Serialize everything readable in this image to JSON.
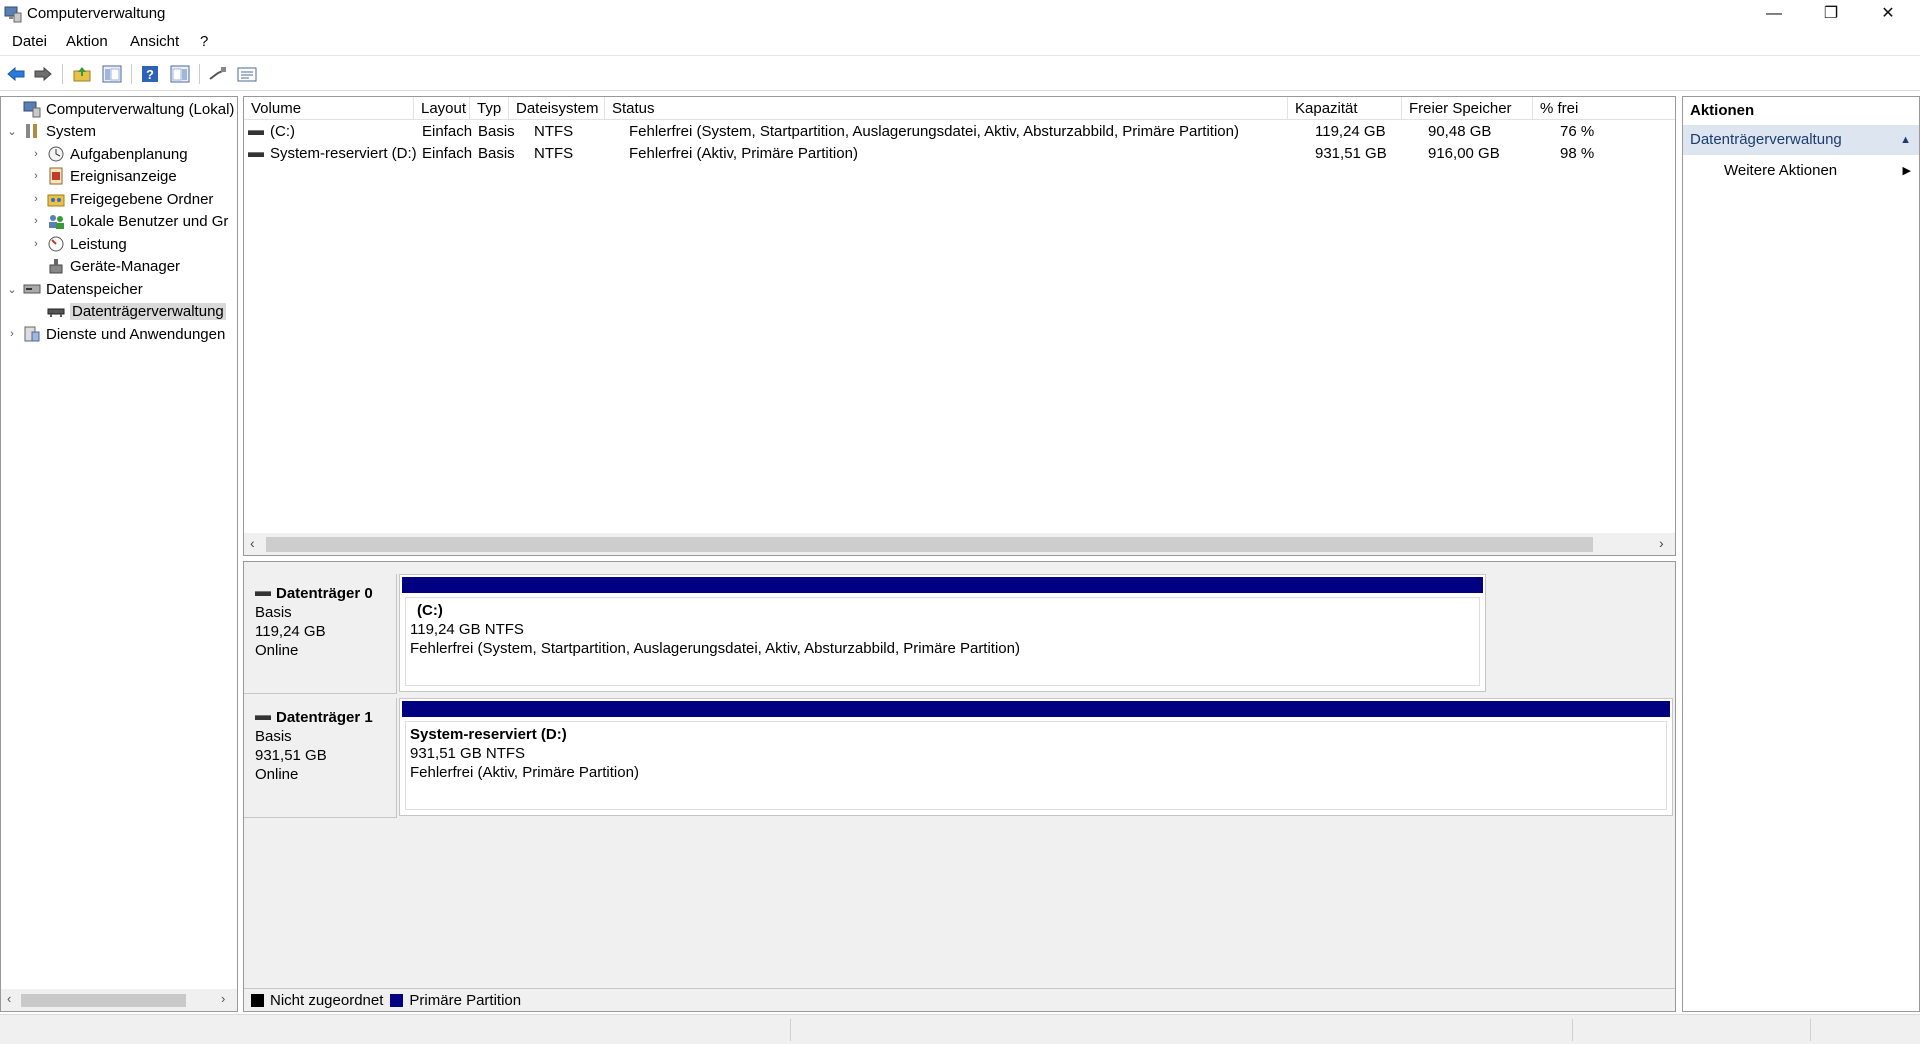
{
  "window": {
    "title": "Computerverwaltung",
    "minimize_glyph": "—",
    "maximize_glyph": "❐",
    "close_glyph": "✕"
  },
  "menu": {
    "items": [
      "Datei",
      "Aktion",
      "Ansicht",
      "?"
    ]
  },
  "toolbar": {
    "icons": [
      "back-arrow-icon",
      "forward-arrow-icon",
      "up-folder-icon",
      "show-hide-console-tree-icon",
      "help-icon",
      "show-hide-action-pane-icon",
      "connect-icon",
      "properties-icon"
    ]
  },
  "tree": {
    "items": [
      {
        "label": "Computerverwaltung (Lokal)",
        "chev": "",
        "icon": "computer-management-icon",
        "level": 0
      },
      {
        "label": "System",
        "chev": "⌄",
        "icon": "system-tools-icon",
        "level": 0
      },
      {
        "label": "Aufgabenplanung",
        "chev": "›",
        "icon": "task-scheduler-icon",
        "level": 1
      },
      {
        "label": "Ereignisanzeige",
        "chev": "›",
        "icon": "event-viewer-icon",
        "level": 1
      },
      {
        "label": "Freigegebene Ordner",
        "chev": "›",
        "icon": "shared-folders-icon",
        "level": 1
      },
      {
        "label": "Lokale Benutzer und Gr",
        "chev": "›",
        "icon": "local-users-icon",
        "level": 1
      },
      {
        "label": "Leistung",
        "chev": "›",
        "icon": "performance-icon",
        "level": 1
      },
      {
        "label": "Geräte-Manager",
        "chev": "",
        "icon": "device-manager-icon",
        "level": 1
      },
      {
        "label": "Datenspeicher",
        "chev": "⌄",
        "icon": "storage-icon",
        "level": 0
      },
      {
        "label": "Datenträgerverwaltung",
        "chev": "",
        "icon": "disk-management-icon",
        "level": 1,
        "selected": true
      },
      {
        "label": "Dienste und Anwendungen",
        "chev": "›",
        "icon": "services-apps-icon",
        "level": 0
      }
    ],
    "scroll_left": "‹",
    "scroll_right": "›"
  },
  "volumes": {
    "columns": [
      "Volume",
      "Layout",
      "Typ",
      "Dateisystem",
      "Status",
      "Kapazität",
      "Freier Speicher",
      "% frei"
    ],
    "rows": [
      {
        "volume": "(C:)",
        "layout": "Einfach",
        "typ": "Basis",
        "fs": "NTFS",
        "status": "Fehlerfrei (System, Startpartition, Auslagerungsdatei, Aktiv, Absturzabbild, Primäre Partition)",
        "capacity": "119,24 GB",
        "free": "90,48 GB",
        "pct": "76 %"
      },
      {
        "volume": "System-reserviert (D:)",
        "layout": "Einfach",
        "typ": "Basis",
        "fs": "NTFS",
        "status": "Fehlerfrei (Aktiv, Primäre Partition)",
        "capacity": "931,51 GB",
        "free": "916,00 GB",
        "pct": "98 %"
      }
    ],
    "scroll_left": "‹",
    "scroll_right": "›"
  },
  "disks": [
    {
      "name": "Datenträger 0",
      "type": "Basis",
      "size": "119,24 GB",
      "state": "Online",
      "partition": {
        "name": "(C:)",
        "size_fs": "119,24 GB NTFS",
        "status": "Fehlerfrei (System, Startpartition, Auslagerungsdatei, Aktiv, Absturzabbild, Primäre Partition)"
      }
    },
    {
      "name": "Datenträger 1",
      "type": "Basis",
      "size": "931,51 GB",
      "state": "Online",
      "partition": {
        "name": "System-reserviert  (D:)",
        "size_fs": "931,51 GB NTFS",
        "status": "Fehlerfrei (Aktiv, Primäre Partition)"
      }
    }
  ],
  "legend": {
    "unallocated": "Nicht zugeordnet",
    "primary": "Primäre Partition",
    "unallocated_color": "#000000",
    "primary_color": "#000080"
  },
  "actions": {
    "header": "Aktionen",
    "section": "Datenträgerverwaltung",
    "section_glyph": "▲",
    "item": "Weitere Aktionen",
    "item_glyph": "▶"
  }
}
